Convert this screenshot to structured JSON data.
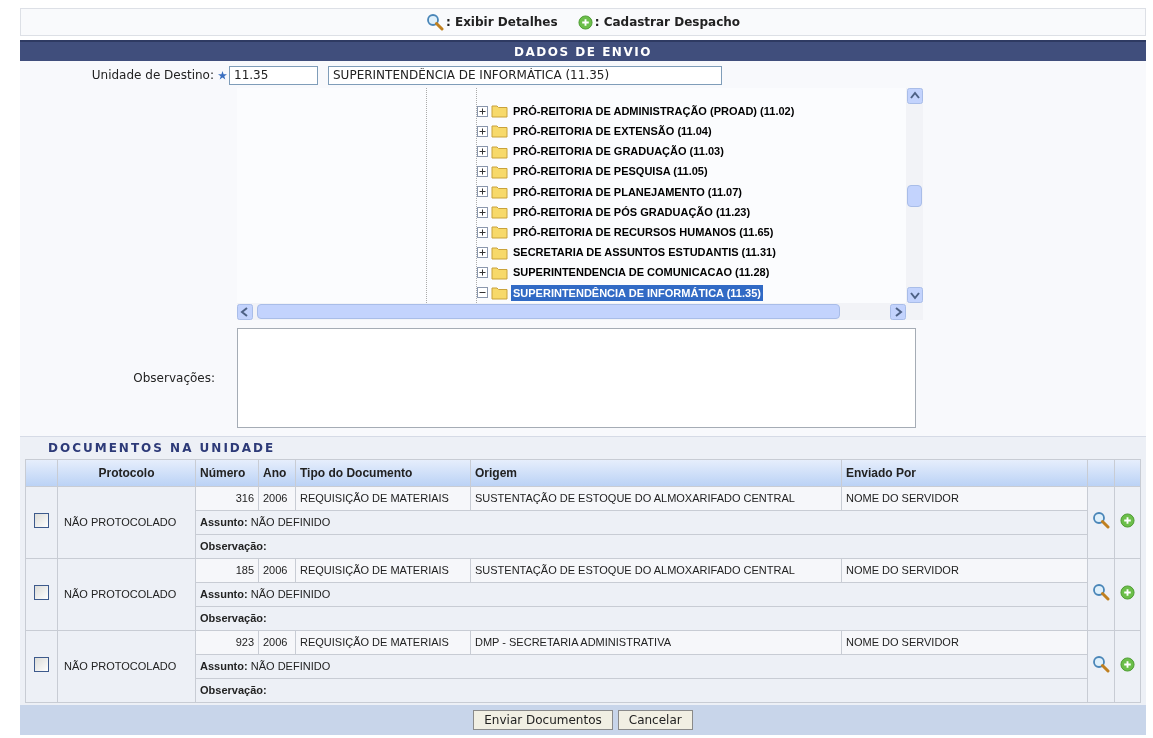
{
  "legend": [
    {
      "kind": "view",
      "label": ": Exibir Detalhes"
    },
    {
      "kind": "add",
      "label": ": Cadastrar Despacho"
    }
  ],
  "section_title": "DADOS DE ENVIO",
  "destination": {
    "label": "Unidade de Destino:",
    "code": "11.35",
    "name": "SUPERINTENDÊNCIA DE INFORMÁTICA (11.35)"
  },
  "tree": [
    {
      "label": "PRÓ-REITORIA DE ADMINISTRAÇÃO (PROAD) (11.02)",
      "expanded": false,
      "selected": false
    },
    {
      "label": "PRÓ-REITORIA DE EXTENSÃO (11.04)",
      "expanded": false,
      "selected": false
    },
    {
      "label": "PRÓ-REITORIA DE GRADUAÇÃO (11.03)",
      "expanded": false,
      "selected": false
    },
    {
      "label": "PRÓ-REITORIA DE PESQUISA (11.05)",
      "expanded": false,
      "selected": false
    },
    {
      "label": "PRÓ-REITORIA DE PLANEJAMENTO (11.07)",
      "expanded": false,
      "selected": false
    },
    {
      "label": "PRÓ-REITORIA DE PÓS GRADUAÇÃO (11.23)",
      "expanded": false,
      "selected": false
    },
    {
      "label": "PRÓ-REITORIA DE RECURSOS HUMANOS (11.65)",
      "expanded": false,
      "selected": false
    },
    {
      "label": "SECRETARIA DE ASSUNTOS ESTUDANTIS (11.31)",
      "expanded": false,
      "selected": false
    },
    {
      "label": "SUPERINTENDENCIA DE COMUNICACAO (11.28)",
      "expanded": false,
      "selected": false
    },
    {
      "label": "SUPERINTENDÊNCIA DE INFORMÁTICA (11.35)",
      "expanded": true,
      "selected": true
    }
  ],
  "notes_label": "Observações:",
  "documents": {
    "title": "DOCUMENTOS NA UNIDADE",
    "columns": [
      "Protocolo",
      "Número",
      "Ano",
      "Tipo do Documento",
      "Origem",
      "Enviado Por"
    ],
    "rows": [
      {
        "checked": false,
        "protocol": "NÃO PROTOCOLADO",
        "number": "316",
        "year": "2006",
        "type": "REQUISIÇÃO DE MATERIAIS",
        "origin": "SUSTENTAÇÃO DE ESTOQUE DO ALMOXARIFADO CENTRAL",
        "sender": "NOME DO SERVIDOR",
        "subject_label": "Assunto:",
        "subject": "NÃO DEFINIDO",
        "note_label": "Observação:"
      },
      {
        "checked": false,
        "protocol": "NÃO PROTOCOLADO",
        "number": "185",
        "year": "2006",
        "type": "REQUISIÇÃO DE MATERIAIS",
        "origin": "SUSTENTAÇÃO DE ESTOQUE DO ALMOXARIFADO CENTRAL",
        "sender": "NOME DO SERVIDOR",
        "subject_label": "Assunto:",
        "subject": "NÃO DEFINIDO",
        "note_label": "Observação:"
      },
      {
        "checked": false,
        "protocol": "NÃO PROTOCOLADO",
        "number": "923",
        "year": "2006",
        "type": "REQUISIÇÃO DE MATERIAIS",
        "origin": "DMP - SECRETARIA ADMINISTRATIVA",
        "sender": "NOME DO SERVIDOR",
        "subject_label": "Assunto:",
        "subject": "NÃO DEFINIDO",
        "note_label": "Observação:"
      }
    ]
  },
  "buttons": [
    "Enviar Documentos",
    "Cancelar"
  ]
}
